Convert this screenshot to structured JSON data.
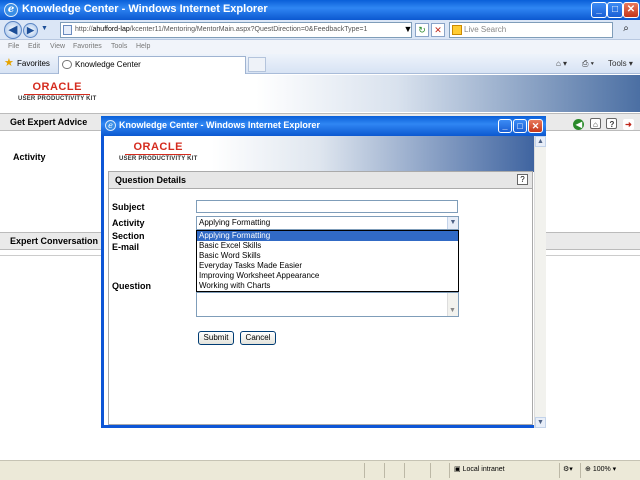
{
  "browser": {
    "title": "Knowledge Center - Windows Internet Explorer",
    "url_host": "ahufford-lap",
    "url_path": "/kcenter11/Mentoring/MentorMain.aspx?QuestDirection=0&FeedbackType=1",
    "url_scheme": "http://",
    "search_placeholder": "Live Search",
    "menu": [
      "File",
      "Edit",
      "View",
      "Favorites",
      "Tools",
      "Help"
    ],
    "favorites_label": "Favorites",
    "tab_label": "Knowledge Center",
    "tools_label": "Tools"
  },
  "page": {
    "logo_word": "ORACLE",
    "logo_sub": "USER PRODUCTIVITY KIT",
    "get_expert_advice": "Get Expert Advice",
    "activity_label": "Activity",
    "expert_conversation": "Expert Conversation"
  },
  "popup": {
    "title": "Knowledge Center - Windows Internet Explorer",
    "logo_word": "ORACLE",
    "logo_sub": "USER PRODUCTIVITY KIT",
    "section_title": "Question Details",
    "help_label": "?",
    "labels": {
      "subject": "Subject",
      "activity": "Activity",
      "section": "Section",
      "email": "E-mail",
      "question": "Question"
    },
    "activity_selected": "Applying Formatting",
    "activity_options": [
      "Applying Formatting",
      "Basic Excel Skills",
      "Basic Word Skills",
      "Everyday Tasks Made Easier",
      "Improving Worksheet Appearance",
      "Working with Charts"
    ],
    "submit_label": "Submit",
    "cancel_label": "Cancel"
  },
  "status": {
    "zone": "Local intranet",
    "zoom": "100%"
  }
}
